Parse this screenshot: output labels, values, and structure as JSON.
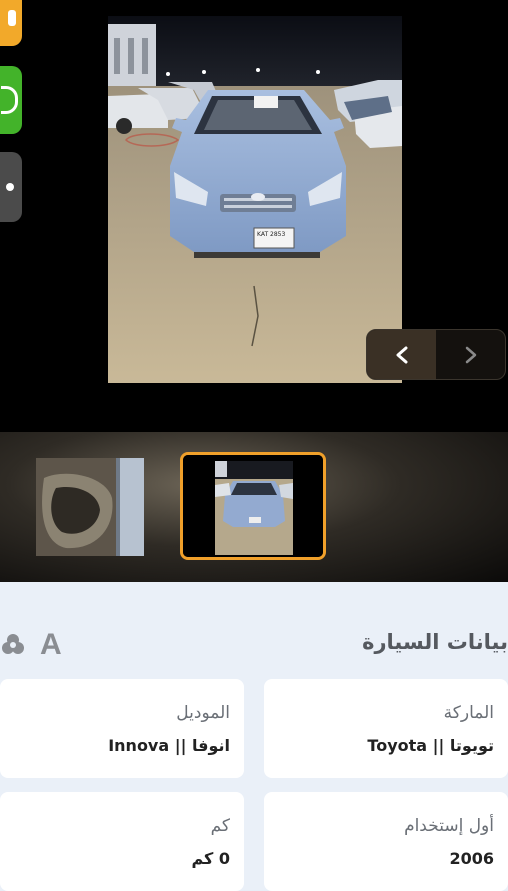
{
  "gallery": {
    "main_photo_alt": "Toyota",
    "plate_text": "KAT 2853"
  },
  "car_section": {
    "title": "بيانات السيارة",
    "font_letter": "A"
  },
  "fields": [
    {
      "label": "الماركة",
      "value": "تويوتا || Toyota"
    },
    {
      "label": "الموديل",
      "value": "انوفا || Innova"
    },
    {
      "label": "أول إستخدام",
      "value": "2006"
    },
    {
      "label": "كم",
      "value": "0 كم"
    }
  ],
  "colors": {
    "accent": "#f0a02a",
    "whatsapp": "#43b32a",
    "section_bg": "#eaf0f8",
    "card_bg": "#ffffff"
  }
}
